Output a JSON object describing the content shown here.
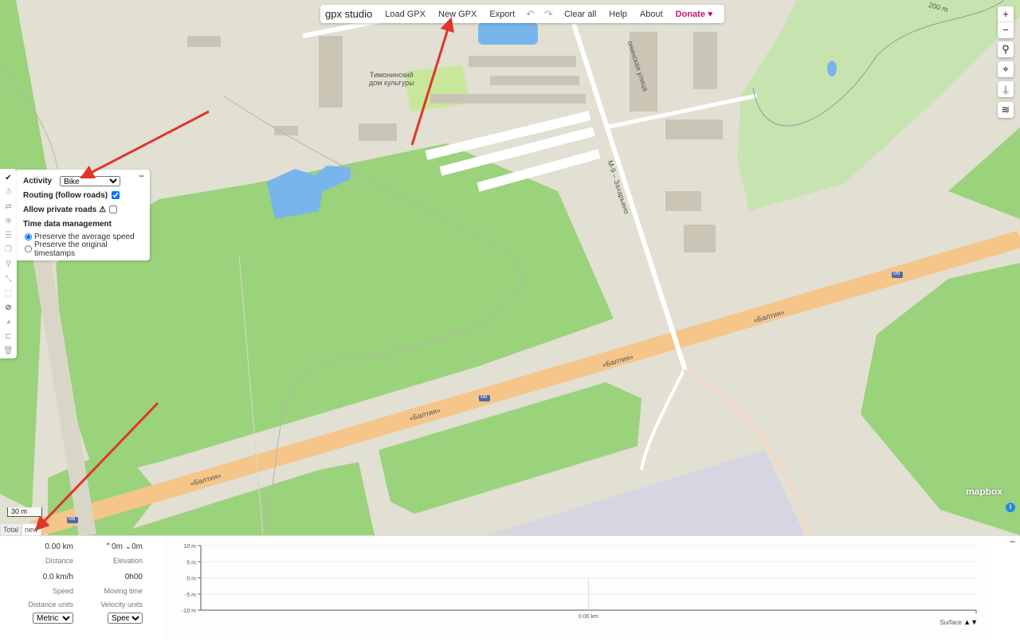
{
  "menu": {
    "logo": "gpx studio",
    "items": [
      "Load GPX",
      "New GPX",
      "Export"
    ],
    "undo_icon": "undo-icon",
    "redo_icon": "redo-icon",
    "items2": [
      "Clear all",
      "Help",
      "About"
    ],
    "donate": "Donate",
    "donate_color": "#c8157a"
  },
  "map": {
    "labels": {
      "culture_house_1": "Тимонинский",
      "culture_house_2": "дом культуры",
      "street": "онинская улица",
      "road_m9_zakharino": "М-9 – Захарьино",
      "baltia": "«Балтия»",
      "m9": "M9",
      "distance_200": "200 m"
    },
    "scale": "30 m",
    "attribution": "mapbox",
    "controls": [
      "+",
      "−"
    ]
  },
  "tool_panel": {
    "activity_label": "Activity",
    "activity_value": "Bike",
    "routing_label": "Routing (follow roads)",
    "routing_checked": true,
    "private_label": "Allow private roads",
    "private_checked": false,
    "time_heading": "Time data management",
    "option_avg": "Preserve the average speed",
    "option_orig": "Preserve the original timestamps",
    "selected_option": "Preserve the average speed"
  },
  "file_tabs": [
    "Total",
    "new"
  ],
  "stats": {
    "distance_value": "0.00 km",
    "distance_label": "Distance",
    "elevation_value": "⌃0m ⌄0m",
    "elevation_label": "Elevation",
    "speed_value": "0.0 km/h",
    "speed_label": "Speed",
    "moving_value": "0h00",
    "moving_label": "Moving time",
    "distance_units_label": "Distance units",
    "distance_units_value": "Metric",
    "velocity_units_label": "Velocity units",
    "velocity_units_value": "Speed"
  },
  "chart_data": {
    "type": "line",
    "y_ticks": [
      "10 m",
      "5 m",
      "0 m",
      "-5 m",
      "-10 m"
    ],
    "ylim": [
      -10,
      10
    ],
    "x_ticks": [
      "0.00 km"
    ],
    "series": [],
    "grid": true,
    "overlay_label": "Surface"
  }
}
